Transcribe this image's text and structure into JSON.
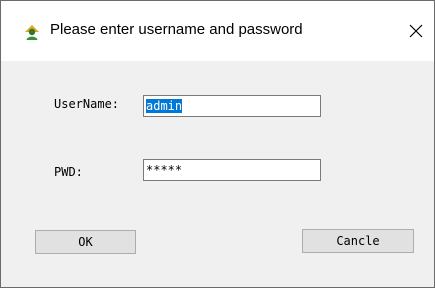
{
  "window": {
    "title": "Please enter username and password",
    "icon": "user-icon"
  },
  "form": {
    "username_label": "UserName:",
    "username_value": "admin",
    "password_label": "PWD:",
    "password_value": "*****"
  },
  "buttons": {
    "ok_label": "OK",
    "cancel_label": "Cancle"
  },
  "colors": {
    "selection": "#0078d7",
    "button_face": "#e1e1e1",
    "dialog_bg": "#f0f0f0"
  }
}
